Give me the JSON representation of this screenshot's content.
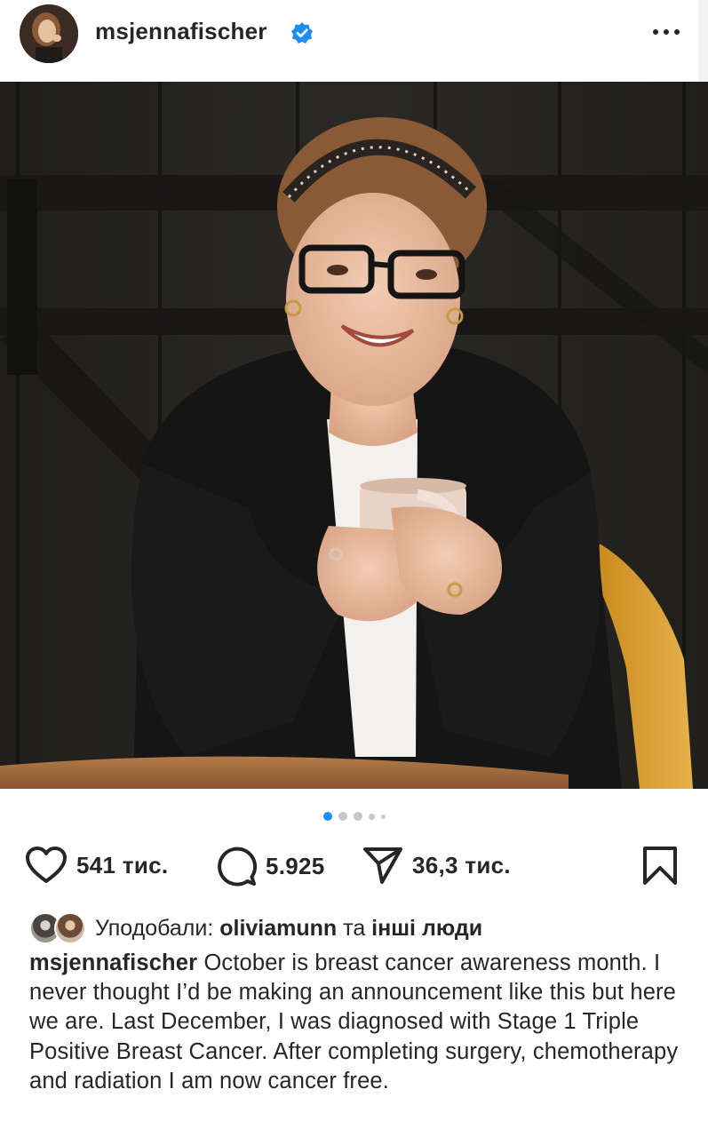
{
  "header": {
    "username": "msjennafischer",
    "verified": true,
    "avatar_icon": "profile-avatar",
    "more_icon": "more-horizontal-icon"
  },
  "post": {
    "image_icon": "post-photo",
    "carousel": {
      "total_dots": 5,
      "active_index": 0
    }
  },
  "actions": {
    "like_icon": "heart-icon",
    "like_count": "541 тис.",
    "comment_icon": "comment-icon",
    "comment_count": "5.925",
    "share_icon": "send-icon",
    "share_count": "36,3 тис.",
    "save_icon": "bookmark-icon"
  },
  "likes": {
    "prefix": "Уподобали: ",
    "user": "oliviamunn",
    "middle": " та ",
    "others": "інші люди"
  },
  "caption": {
    "user": "msjennafischer",
    "text": "October is breast cancer awareness month. I never thought I’d be making an announcement like this but here we are. Last December, I was diagnosed with Stage 1 Triple Positive Breast Cancer. After completing surgery, chemotherapy and radiation I am now cancer free."
  },
  "colors": {
    "text": "#262626",
    "verified": "#1f8ef1",
    "active_dot": "#1f8ef1",
    "inactive_dot": "#c7c7c7"
  }
}
